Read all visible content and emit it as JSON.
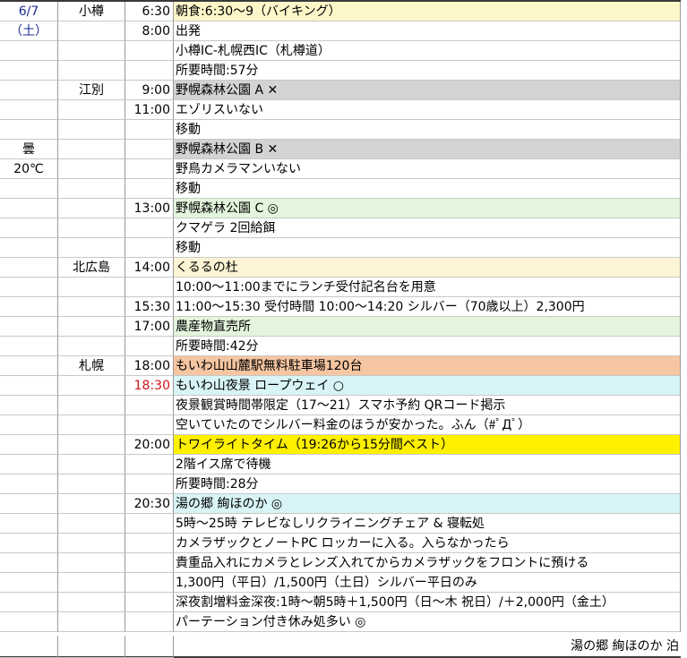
{
  "colors": {
    "yellow": "#fdf6c9",
    "gray": "#d3d3d3",
    "green": "#e3f5dc",
    "cream": "#fcf4d4",
    "orange": "#f6c5a1",
    "cyan": "#d8f4f7",
    "gold": "#fff000",
    "date_blue": "#1f2c8f",
    "time_red": "#d0141c"
  },
  "rows": [
    {
      "c1": "6/7",
      "c2": "小樽",
      "c3": "6:30",
      "c4": "朝食:6:30～9（バイキング）",
      "bg": "yellow"
    },
    {
      "c1": "（土）",
      "c2": "",
      "c3": "8:00",
      "c4": "出発",
      "bg": ""
    },
    {
      "c1": "",
      "c2": "",
      "c3": "",
      "c4": "小樽IC-札幌西IC（札樽道）",
      "bg": ""
    },
    {
      "c1": "",
      "c2": "",
      "c3": "",
      "c4": "所要時間:57分",
      "bg": ""
    },
    {
      "c1": "",
      "c2": "江別",
      "c3": "9:00",
      "c4": "野幌森林公園 A ✕",
      "bg": "gray"
    },
    {
      "c1": "",
      "c2": "",
      "c3": "11:00",
      "c4": "エゾリスいない",
      "bg": ""
    },
    {
      "c1": "",
      "c2": "",
      "c3": "",
      "c4": "移動",
      "bg": ""
    },
    {
      "c1": "曇",
      "c2": "",
      "c3": "",
      "c4": "野幌森林公園 B ✕",
      "bg": "gray"
    },
    {
      "c1": "20℃",
      "c2": "",
      "c3": "",
      "c4": "野鳥カメラマンいない",
      "bg": ""
    },
    {
      "c1": "",
      "c2": "",
      "c3": "",
      "c4": "移動",
      "bg": ""
    },
    {
      "c1": "",
      "c2": "",
      "c3": "13:00",
      "c4": "野幌森林公園 C ◎",
      "bg": "green"
    },
    {
      "c1": "",
      "c2": "",
      "c3": "",
      "c4": "クマゲラ 2回給餌",
      "bg": ""
    },
    {
      "c1": "",
      "c2": "",
      "c3": "",
      "c4": "移動",
      "bg": ""
    },
    {
      "c1": "",
      "c2": "北広島",
      "c3": "14:00",
      "c4": "くるるの杜",
      "bg": "cream"
    },
    {
      "c1": "",
      "c2": "",
      "c3": "",
      "c4": "10:00～11:00までにランチ受付記名台を用意",
      "bg": ""
    },
    {
      "c1": "",
      "c2": "",
      "c3": "15:30",
      "c4": "11:00～15:30 受付時間 10:00～14:20 シルバー（70歳以上）2,300円",
      "bg": ""
    },
    {
      "c1": "",
      "c2": "",
      "c3": "17:00",
      "c4": "農産物直売所",
      "bg": "green"
    },
    {
      "c1": "",
      "c2": "",
      "c3": "",
      "c4": "所要時間:42分",
      "bg": ""
    },
    {
      "c1": "",
      "c2": "札幌",
      "c3": "18:00",
      "c4": "もいわ山山麓駅無料駐車場120台",
      "bg": "orange"
    },
    {
      "c1": "",
      "c2": "",
      "c3": "18:30",
      "c4": "もいわ山夜景 ロープウェイ ○",
      "bg": "cyan",
      "red": true
    },
    {
      "c1": "",
      "c2": "",
      "c3": "",
      "c4": "夜景観賞時間帯限定（17～21）スマホ予約 QRコード掲示",
      "bg": ""
    },
    {
      "c1": "",
      "c2": "",
      "c3": "",
      "c4": "空いていたのでシルバー料金のほうが安かった。ふん（#ﾟДﾟ）",
      "bg": ""
    },
    {
      "c1": "",
      "c2": "",
      "c3": "20:00",
      "c4": "トワイライトタイム（19:26から15分間ベスト）",
      "bg": "gold"
    },
    {
      "c1": "",
      "c2": "",
      "c3": "",
      "c4": "2階イス席で待機",
      "bg": ""
    },
    {
      "c1": "",
      "c2": "",
      "c3": "",
      "c4": "所要時間:28分",
      "bg": ""
    },
    {
      "c1": "",
      "c2": "",
      "c3": "20:30",
      "c4": "湯の郷 絢ほのか ◎",
      "bg": "cyan"
    },
    {
      "c1": "",
      "c2": "",
      "c3": "",
      "c4": "5時～25時 テレビなしリクライニングチェア & 寝転処",
      "bg": ""
    },
    {
      "c1": "",
      "c2": "",
      "c3": "",
      "c4": "カメラザックとノートPC ロッカーに入る。入らなかったら",
      "bg": ""
    },
    {
      "c1": "",
      "c2": "",
      "c3": "",
      "c4": "貴重品入れにカメラとレンズ入れてからカメラザックをフロントに預ける",
      "bg": ""
    },
    {
      "c1": "",
      "c2": "",
      "c3": "",
      "c4": "1,300円（平日）/1,500円（土日）シルバー平日のみ",
      "bg": ""
    },
    {
      "c1": "",
      "c2": "",
      "c3": "",
      "c4": "深夜割増料金深夜:1時～朝5時＋1,500円（日～木 祝日）/＋2,000円（金土）",
      "bg": ""
    },
    {
      "c1": "",
      "c2": "",
      "c3": "",
      "c4": "パーテーション付き休み処多い ◎",
      "bg": ""
    }
  ],
  "footer": "湯の郷 絢ほのか 泊"
}
